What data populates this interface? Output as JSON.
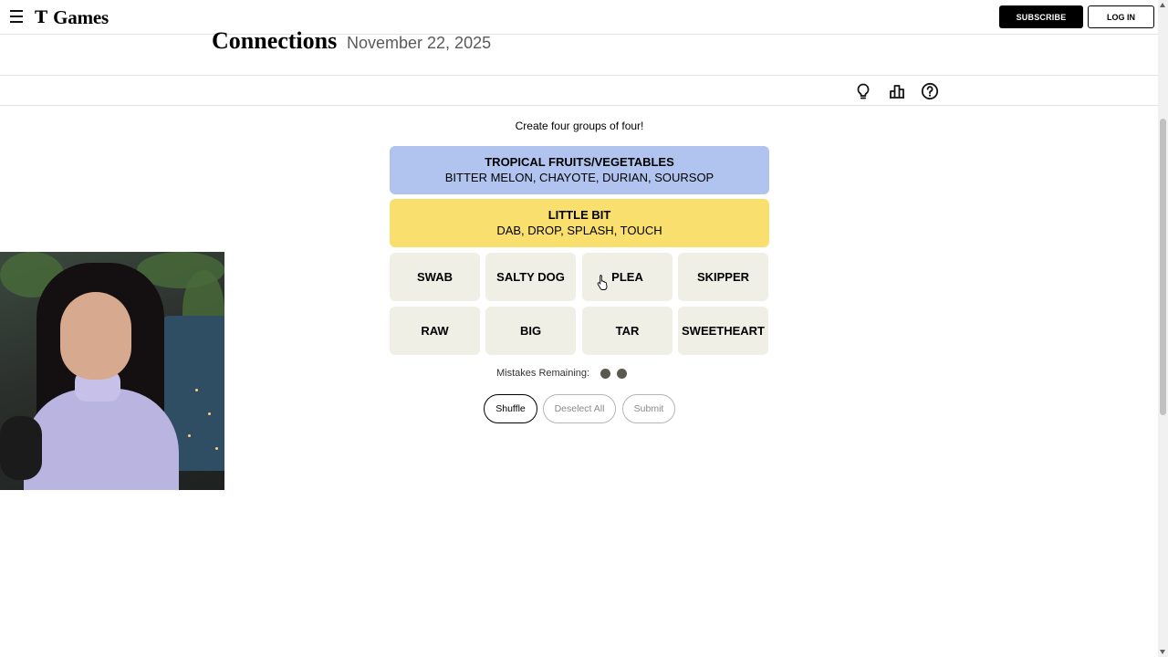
{
  "header": {
    "brand_mark": "T",
    "brand_name": "Games",
    "subscribe_label": "SUBSCRIBE",
    "login_label": "LOG IN"
  },
  "puzzle": {
    "title": "Connections",
    "date": "November 22, 2025",
    "instructions": "Create four groups of four!"
  },
  "toolbar": {
    "icons": [
      "hint-lightbulb-icon",
      "leaderboard-icon",
      "help-question-icon"
    ]
  },
  "solved_groups": [
    {
      "title": "TROPICAL FRUITS/VEGETABLES",
      "members": "BITTER MELON, CHAYOTE, DURIAN, SOURSOP",
      "color": "#b0c4ef"
    },
    {
      "title": "LITTLE BIT",
      "members": "DAB, DROP, SPLASH, TOUCH",
      "color": "#f9df6d"
    }
  ],
  "tiles": [
    "SWAB",
    "SALTY DOG",
    "PLEA",
    "SKIPPER",
    "RAW",
    "BIG",
    "TAR",
    "SWEETHEART"
  ],
  "mistakes": {
    "label": "Mistakes Remaining:",
    "remaining": 2
  },
  "actions": {
    "shuffle_label": "Shuffle",
    "deselect_label": "Deselect All",
    "submit_label": "Submit"
  },
  "colors": {
    "tile_bg": "#efefe6",
    "blue_group": "#b0c4ef",
    "yellow_group": "#f9df6d",
    "mistake_dot": "#5a594e"
  }
}
